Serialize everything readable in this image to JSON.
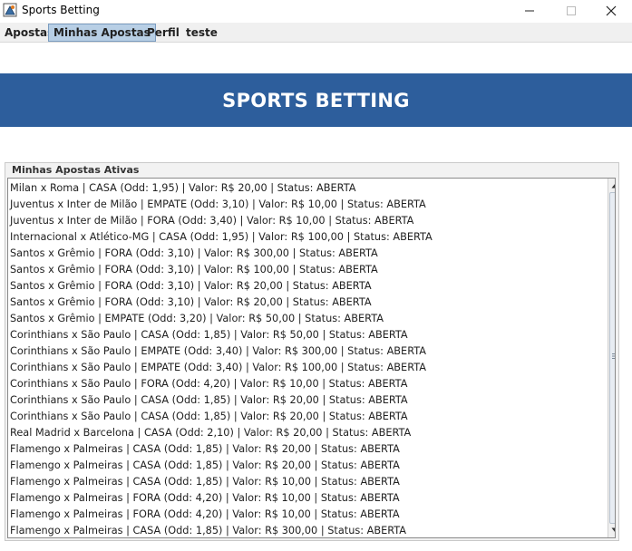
{
  "window": {
    "title": "Sports Betting"
  },
  "menu": {
    "items": [
      {
        "label": "Apostas"
      },
      {
        "label": "Minhas Apostas",
        "active": true
      },
      {
        "label": "Perfil"
      },
      {
        "label": "teste"
      }
    ]
  },
  "banner": {
    "title": "SPORTS BETTING",
    "color": "#2d5e9c"
  },
  "panel": {
    "title": "Minhas Apostas Ativas",
    "items": [
      "Milan x Roma | CASA (Odd: 1,95) | Valor: R$ 20,00 | Status: ABERTA",
      "Juventus x Inter de Milão | EMPATE (Odd: 3,10) | Valor: R$ 10,00 | Status: ABERTA",
      "Juventus x Inter de Milão | FORA (Odd: 3,40) | Valor: R$ 10,00 | Status: ABERTA",
      "Internacional x Atlético-MG | CASA (Odd: 1,95) | Valor: R$ 100,00 | Status: ABERTA",
      "Santos x Grêmio | FORA (Odd: 3,10) | Valor: R$ 300,00 | Status: ABERTA",
      "Santos x Grêmio | FORA (Odd: 3,10) | Valor: R$ 100,00 | Status: ABERTA",
      "Santos x Grêmio | FORA (Odd: 3,10) | Valor: R$ 20,00 | Status: ABERTA",
      "Santos x Grêmio | FORA (Odd: 3,10) | Valor: R$ 20,00 | Status: ABERTA",
      "Santos x Grêmio | EMPATE (Odd: 3,20) | Valor: R$ 50,00 | Status: ABERTA",
      "Corinthians x São Paulo | CASA (Odd: 1,85) | Valor: R$ 50,00 | Status: ABERTA",
      "Corinthians x São Paulo | EMPATE (Odd: 3,40) | Valor: R$ 300,00 | Status: ABERTA",
      "Corinthians x São Paulo | EMPATE (Odd: 3,40) | Valor: R$ 100,00 | Status: ABERTA",
      "Corinthians x São Paulo | FORA (Odd: 4,20) | Valor: R$ 10,00 | Status: ABERTA",
      "Corinthians x São Paulo | CASA (Odd: 1,85) | Valor: R$ 20,00 | Status: ABERTA",
      "Corinthians x São Paulo | CASA (Odd: 1,85) | Valor: R$ 20,00 | Status: ABERTA",
      "Real Madrid x Barcelona | CASA (Odd: 2,10) | Valor: R$ 20,00 | Status: ABERTA",
      "Flamengo x Palmeiras | CASA (Odd: 1,85) | Valor: R$ 20,00 | Status: ABERTA",
      "Flamengo x Palmeiras | CASA (Odd: 1,85) | Valor: R$ 20,00 | Status: ABERTA",
      "Flamengo x Palmeiras | CASA (Odd: 1,85) | Valor: R$ 10,00 | Status: ABERTA",
      "Flamengo x Palmeiras | FORA (Odd: 4,20) | Valor: R$ 10,00 | Status: ABERTA",
      "Flamengo x Palmeiras | FORA (Odd: 4,20) | Valor: R$ 10,00 | Status: ABERTA",
      "Flamengo x Palmeiras | CASA (Odd: 1,85) | Valor: R$ 300,00 | Status: ABERTA"
    ]
  }
}
